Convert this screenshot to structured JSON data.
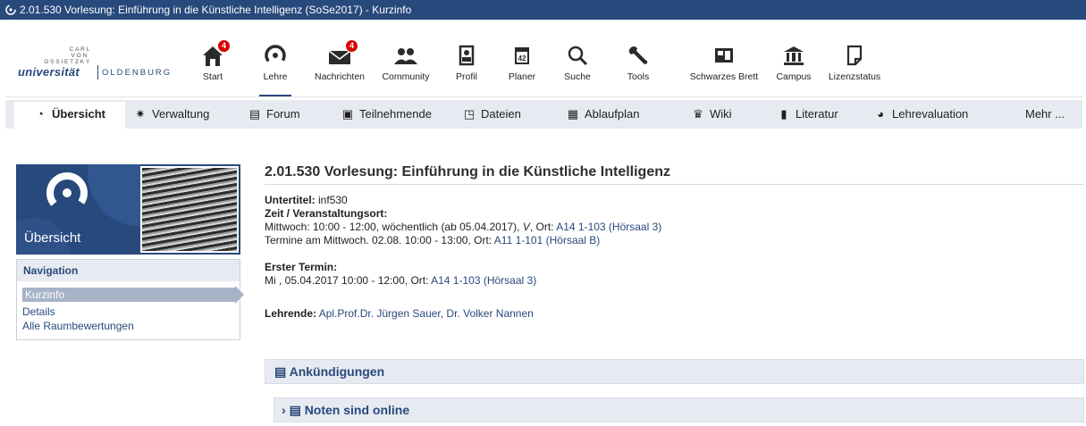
{
  "window": {
    "title": "2.01.530 Vorlesung: Einführung in die Künstliche Intelligenz (SoSe2017) - Kurzinfo"
  },
  "logo": {
    "line1": "CARL",
    "line2": "VON",
    "line3": "OSSIETZKY",
    "universitaet": "universität",
    "oldenburg": "OLDENBURG"
  },
  "topnav": [
    {
      "label": "Start",
      "icon": "home-icon",
      "badge": "4"
    },
    {
      "label": "Lehre",
      "icon": "lehre-icon",
      "active": true
    },
    {
      "label": "Nachrichten",
      "icon": "mail-icon",
      "badge": "4"
    },
    {
      "label": "Community",
      "icon": "community-icon"
    },
    {
      "label": "Profil",
      "icon": "profile-icon"
    },
    {
      "label": "Planer",
      "icon": "calendar-icon"
    },
    {
      "label": "Suche",
      "icon": "search-icon"
    },
    {
      "label": "Tools",
      "icon": "wrench-icon"
    },
    {
      "label": "Schwarzes Brett",
      "icon": "board-icon"
    },
    {
      "label": "Campus",
      "icon": "campus-icon"
    },
    {
      "label": "Lizenzstatus",
      "icon": "license-icon"
    }
  ],
  "tabs": [
    {
      "label": "Übersicht",
      "icon": "lehre-icon",
      "active": true
    },
    {
      "label": "Verwaltung",
      "icon": "gears-icon"
    },
    {
      "label": "Forum",
      "icon": "forum-icon"
    },
    {
      "label": "Teilnehmende",
      "icon": "persons-icon"
    },
    {
      "label": "Dateien",
      "icon": "files-icon"
    },
    {
      "label": "Ablaufplan",
      "icon": "schedule-icon"
    },
    {
      "label": "Wiki",
      "icon": "wiki-icon"
    },
    {
      "label": "Literatur",
      "icon": "book-icon"
    },
    {
      "label": "Lehrevaluation",
      "icon": "evaluation-icon"
    },
    {
      "label": "Mehr ..."
    }
  ],
  "sidebar": {
    "banner_title": "Übersicht",
    "nav_heading": "Navigation",
    "links": [
      "Kurzinfo",
      "Details",
      "Alle Raumbewertungen"
    ]
  },
  "main": {
    "title": "2.01.530 Vorlesung: Einführung in die Künstliche Intelligenz",
    "untertitel_label": "Untertitel:",
    "untertitel_value": "inf530",
    "zeit_label": "Zeit / Veranstaltungsort:",
    "zeit_line1_text": "Mittwoch: 10:00 - 12:00, wöchentlich (ab 05.04.2017),",
    "zeit_line1_v": "V",
    "zeit_line1_ort": ", Ort:",
    "zeit_line1_link": "A14 1-103 (Hörsaal 3)",
    "zeit_line2_text": "Termine am Mittwoch. 02.08. 10:00 - 13:00, Ort:",
    "zeit_line2_link": "A11 1-101 (Hörsaal B)",
    "erster_label": "Erster Termin:",
    "erster_text": "Mi , 05.04.2017 10:00 - 12:00, Ort:",
    "erster_link": "A14 1-103 (Hörsaal 3)",
    "lehrende_label": "Lehrende:",
    "lehrende_value": "Apl.Prof.Dr. Jürgen Sauer, Dr. Volker Nannen"
  },
  "announcements": {
    "heading": "Ankündigungen",
    "item": "Noten sind online"
  },
  "colors": {
    "brand_blue": "#28497c",
    "tab_bg": "#e7ebf1",
    "badge_red": "#d60000"
  }
}
